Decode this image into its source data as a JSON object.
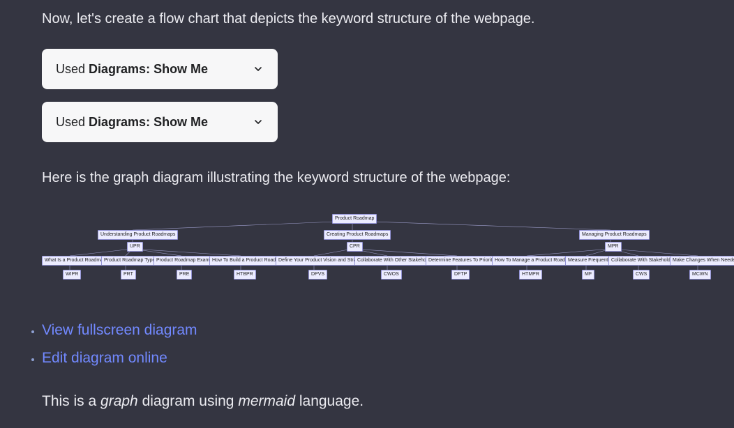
{
  "intro": "Now, let's create a flow chart that depicts the keyword structure of the webpage.",
  "plugin": {
    "used_prefix": "Used ",
    "name": "Diagrams: Show Me"
  },
  "mid": "Here is the graph diagram illustrating the keyword structure of the webpage:",
  "chart_data": {
    "type": "graph",
    "root": {
      "label": "Product Roadmap"
    },
    "level1": [
      {
        "label": "Understanding Product Roadmaps",
        "code": "UPR"
      },
      {
        "label": "Creating Product Roadmaps",
        "code": "CPR"
      },
      {
        "label": "Managing Product Roadmaps",
        "code": "MPR"
      }
    ],
    "leaves": [
      {
        "parent": "UPR",
        "label": "What Is a Product Roadmap?",
        "code": "WIPR"
      },
      {
        "parent": "UPR",
        "label": "Product Roadmap Types",
        "code": "PRT"
      },
      {
        "parent": "UPR",
        "label": "Product Roadmap Examples",
        "code": "PRE"
      },
      {
        "parent": "UPR",
        "label": "How To Build a Product Roadmap",
        "code": "HTBPR"
      },
      {
        "parent": "CPR",
        "label": "Define Your Product Vision and Strategy",
        "code": "DPVS"
      },
      {
        "parent": "CPR",
        "label": "Collaborate With Other Stakeholders",
        "code": "CWOS"
      },
      {
        "parent": "CPR",
        "label": "Determine Features To Prioritize",
        "code": "DFTP"
      },
      {
        "parent": "MPR",
        "label": "How To Manage a Product Roadmap",
        "code": "HTMPR"
      },
      {
        "parent": "MPR",
        "label": "Measure Frequently",
        "code": "MF"
      },
      {
        "parent": "MPR",
        "label": "Collaborate With Stakeholders",
        "code": "CWS"
      },
      {
        "parent": "MPR",
        "label": "Make Changes When Needed",
        "code": "MCWN"
      }
    ]
  },
  "links": {
    "fullscreen": "View fullscreen diagram",
    "edit": "Edit diagram online"
  },
  "footer": {
    "prefix": "This is a ",
    "word1": "graph",
    "mid": " diagram using ",
    "word2": "mermaid",
    "suffix": " language."
  }
}
